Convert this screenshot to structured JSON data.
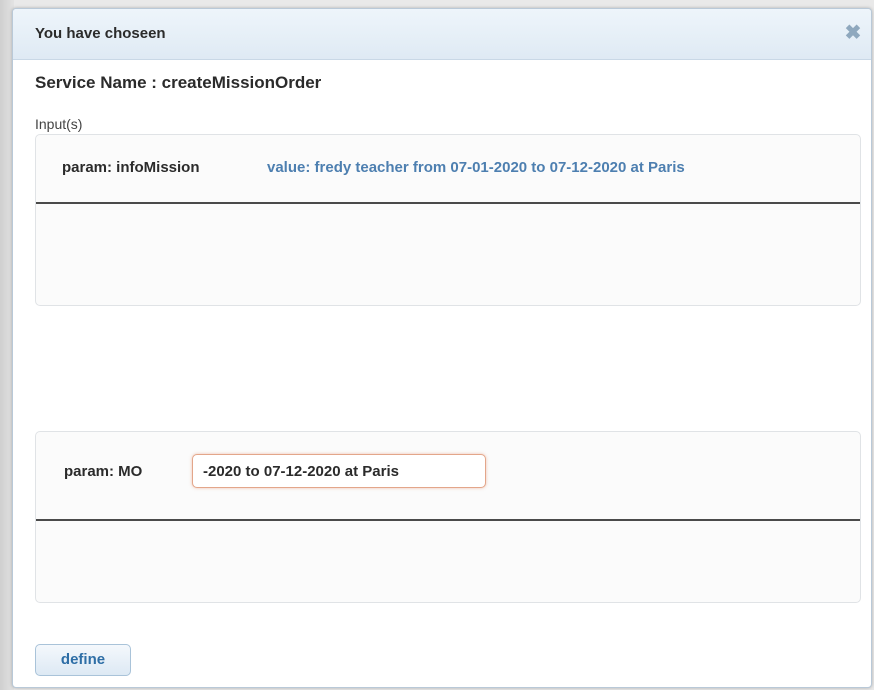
{
  "dialog": {
    "title": "You have choseen",
    "close_icon": "close-icon",
    "service_name": "Service Name : createMissionOrder",
    "inputs_label": "Input(s)"
  },
  "params": [
    {
      "label": "param: infoMission",
      "value": "value: fredy teacher from 07-01-2020 to 07-12-2020 at Paris"
    },
    {
      "label": "param: MO",
      "input_value": "-2020 to 07-12-2020 at Paris"
    }
  ],
  "actions": {
    "define_label": "define"
  },
  "colors": {
    "accent": "#4d7fb0",
    "titlebar": "#dfeaf4",
    "focus_border": "#e3a68a"
  }
}
